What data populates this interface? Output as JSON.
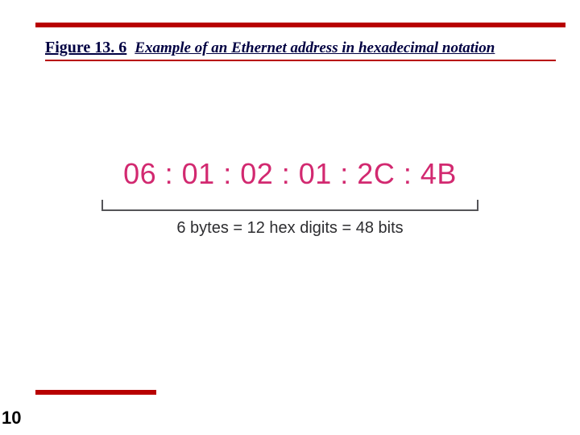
{
  "figure": {
    "number": "Figure 13. 6",
    "caption": "Example of an Ethernet address in hexadecimal notation"
  },
  "mac_address": "06 : 01 : 02 : 01 : 2C : 4B",
  "subcaption": "6 bytes = 12 hex digits = 48 bits",
  "page_number": "10",
  "colors": {
    "rule": "#b80000",
    "heading": "#000042",
    "address": "#d22970"
  }
}
